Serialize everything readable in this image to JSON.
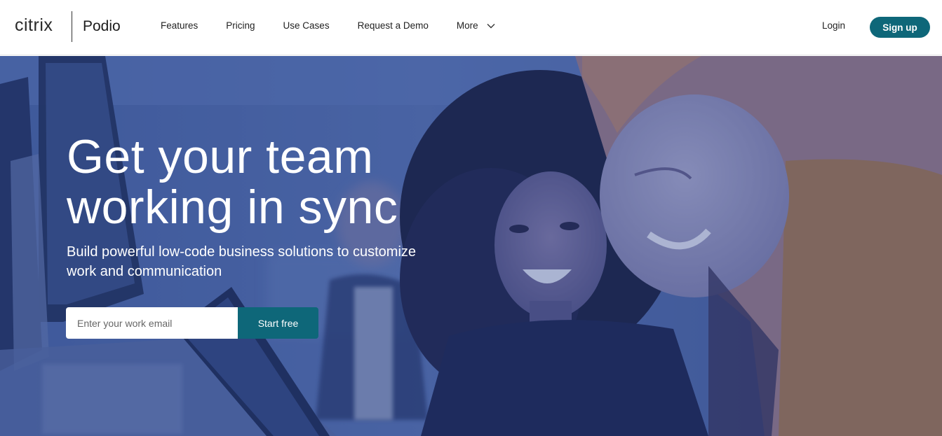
{
  "brand": {
    "company": "citrix",
    "product": "Podio"
  },
  "nav": {
    "items": [
      {
        "label": "Features"
      },
      {
        "label": "Pricing"
      },
      {
        "label": "Use Cases"
      },
      {
        "label": "Request a Demo"
      },
      {
        "label": "More"
      }
    ],
    "login_label": "Login",
    "signup_label": "Sign up"
  },
  "hero": {
    "title_line1": "Get your team",
    "title_line2": "working in sync",
    "subtitle_line1": "Build powerful low-code business solutions to customize",
    "subtitle_line2": "work and communication",
    "email_placeholder": "Enter your work email",
    "email_value": "",
    "cta_label": "Start free",
    "background_image": "office-colleagues-photo"
  },
  "colors": {
    "accent": "#0e6779",
    "hero_tint": "#3f5a97",
    "text_on_dark": "#ffffff"
  }
}
